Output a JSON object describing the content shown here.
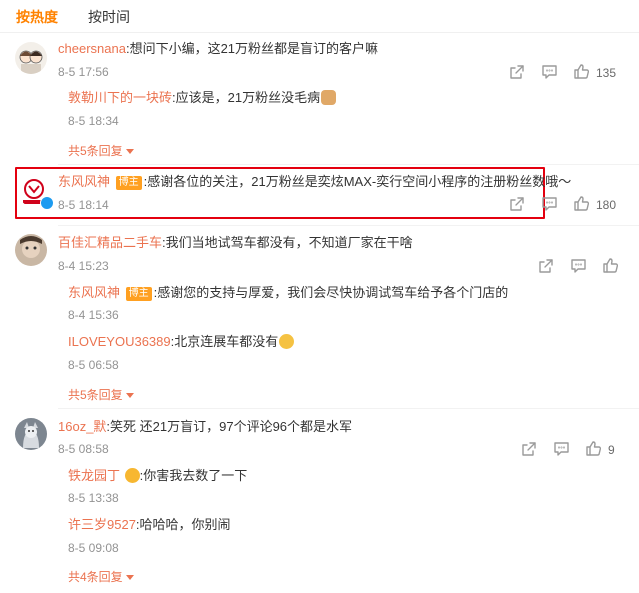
{
  "tabs": {
    "hot": "按热度",
    "time": "按时间"
  },
  "colors": {
    "accent": "#ff8200",
    "username": "#eb7350",
    "highlight": "#e4000f",
    "badge": "#ffa021"
  },
  "comments": [
    {
      "user": "cheersnana",
      "text": ":想问下小编，这21万粉丝都是盲订的客户嘛",
      "time": "8-5 17:56",
      "likes": "135",
      "replies": [
        {
          "user": "敦勒川下的一块砖",
          "text": ":应该是，21万粉丝没毛病",
          "time": "8-5 18:34",
          "emoji": "dog-emoji"
        }
      ],
      "more": "共5条回复"
    },
    {
      "user": "东风风神",
      "badge": "博主",
      "text": ":感谢各位的关注，21万粉丝是奕炫MAX-奕行空间小程序的注册粉丝数哦～",
      "time": "8-5 18:14",
      "likes": "180"
    },
    {
      "user": "百佳汇精品二手车",
      "text": ":我们当地试驾车都没有，不知道厂家在干啥",
      "time": "8-4 15:23",
      "replies": [
        {
          "user": "东风风神",
          "badge": "博主",
          "text": ":感谢您的支持与厚爱，我们会尽快协调试驾车给予各个门店的",
          "time": "8-4 15:36"
        },
        {
          "user": "ILOVEYOU36389",
          "text": ":北京连展车都没有",
          "time": "8-5 06:58",
          "emoji": "shy-face-emoji"
        }
      ],
      "more": "共5条回复"
    },
    {
      "user": "16oz_默",
      "text": ":笑死 还21万盲订，97个评论96个都是水军",
      "time": "8-5 08:58",
      "likes": "9",
      "replies": [
        {
          "user": "铁龙园丁",
          "text": ":你害我去数了一下",
          "time": "8-5 13:38",
          "emoji": "kiss-face-emoji"
        },
        {
          "user": "许三岁9527",
          "text": ":哈哈哈，你别闹",
          "time": "8-5 09:08"
        }
      ],
      "more": "共4条回复"
    }
  ]
}
